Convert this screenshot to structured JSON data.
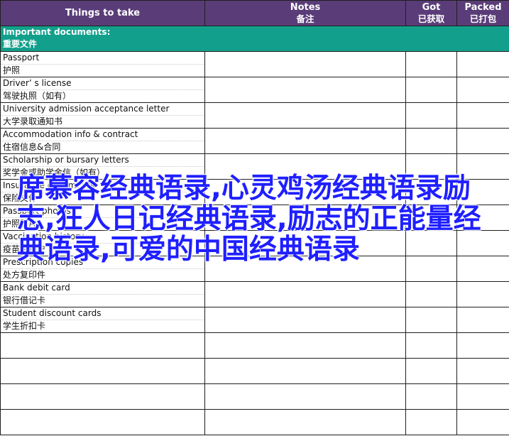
{
  "headers": {
    "col1": {
      "en": "Things to take",
      "zh": ""
    },
    "col2": {
      "en": "Notes",
      "zh": "备注"
    },
    "col3": {
      "en": "Got",
      "zh": "已获取"
    },
    "col4": {
      "en": "Packed",
      "zh": "已打包"
    }
  },
  "section": {
    "en": "Important documents:",
    "zh": "重要文件"
  },
  "items": [
    {
      "en": "Passport",
      "zh": "护照"
    },
    {
      "en": "Driver’ s license",
      "zh": "驾驶执照（如有）"
    },
    {
      "en": "University admission acceptance letter",
      "zh": "大学录取通知书"
    },
    {
      "en": "Accommodation info & contract",
      "zh": "住宿信息&合同"
    },
    {
      "en": "Scholarship or bursary letters",
      "zh": "奖学金或助学金信（如有）"
    },
    {
      "en": "Insurance documents",
      "zh": "保险文件"
    },
    {
      "en": "Passport photos",
      "zh": "护照照片"
    },
    {
      "en": "Vaccination history",
      "zh": "疫苗接种史"
    },
    {
      "en": "Prescription copies",
      "zh": "处方复印件"
    },
    {
      "en": "Bank debit card",
      "zh": "银行借记卡"
    },
    {
      "en": "Student discount cards",
      "zh": "学生折扣卡"
    }
  ],
  "watermark": "席慕容经典语录,心灵鸡汤经典语录励志,狂人日记经典语录,励志的正能量经典语录,可爱的中国经典语录"
}
